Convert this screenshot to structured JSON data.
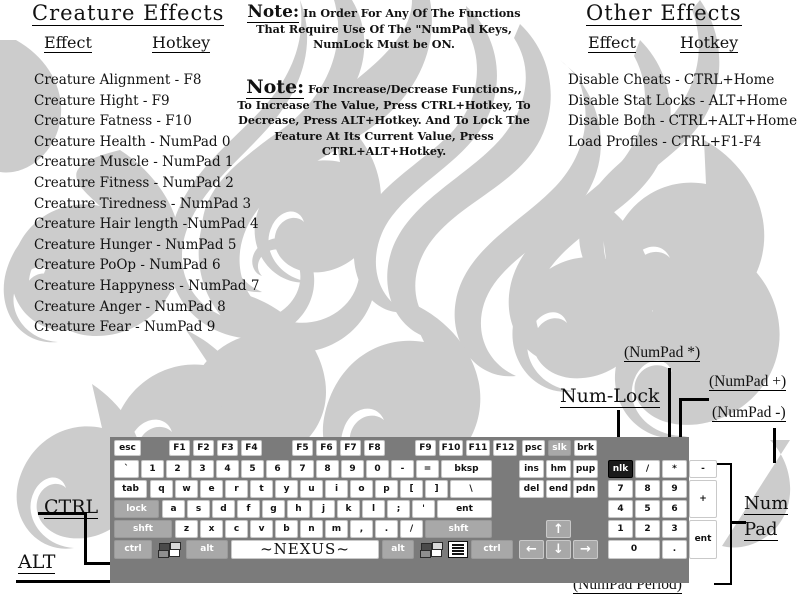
{
  "meta": {
    "accent_dark": "#1b1b1b",
    "key_face": "#ffffff",
    "key_grey": "#a8a8a8",
    "keyboard_body": "#7b7b7b",
    "watermark": "#cccccc"
  },
  "creature_effects": {
    "title": "Creature Effects",
    "col_effect": "Effect",
    "col_hotkey": "Hotkey",
    "rows": [
      "Creature Alignment - F8",
      "Creature Hight - F9",
      "Creature Fatness - F10",
      "Creature Health - NumPad 0",
      "Creature Muscle - NumPad 1",
      "Creature Fitness - NumPad 2",
      "Creature Tiredness - NumPad 3",
      "Creature Hair length -NumPad 4",
      "Creature Hunger - NumPad 5",
      "Creature PoOp - NumPad 6",
      "Creature Happyness - NumPad 7",
      "Creature Anger - NumPad 8",
      "Creature Fear - NumPad 9"
    ]
  },
  "note1": {
    "label": "Note:",
    "lines": [
      "In Order For Any Of The Functions",
      "That Require Use Of The \"NumPad Keys,",
      "NumLock Must be ON."
    ]
  },
  "note2": {
    "label": "Note:",
    "lines": [
      "For Increase/Decrease Functions,,",
      "To Increase The Value, Press CTRL+Hotkey, To",
      "Decrease, Press ALT+Hotkey. And To Lock The",
      "Feature At Its Current Value, Press CTRL+ALT+Hotkey."
    ]
  },
  "other_effects": {
    "title": "Other Effects",
    "col_effect": "Effect",
    "col_hotkey": "Hotkey",
    "rows": [
      "Disable Cheats - CTRL+Home",
      "Disable Stat Locks - ALT+Home",
      "Disable Both - CTRL+ALT+Home",
      "Load Profiles - CTRL+F1-F4"
    ]
  },
  "callouts": {
    "numpad_star": "(NumPad *)",
    "numpad_plus": "(NumPad +)",
    "numpad_minus": "(NumPad -)",
    "num_lock": "Num-Lock",
    "num_pad_line1": "Num",
    "num_pad_line2": "Pad",
    "ctrl": "CTRL",
    "alt": "ALT",
    "numpad_period": "(NumPad Period)"
  },
  "keyboard": {
    "rows": {
      "function_row": [
        {
          "label": "esc",
          "style": "white",
          "w": 26
        },
        {
          "label": "F1",
          "style": "white",
          "w": 22
        },
        {
          "label": "F2",
          "style": "white",
          "w": 22
        },
        {
          "label": "F3",
          "style": "white",
          "w": 22
        },
        {
          "label": "F4",
          "style": "white",
          "w": 22
        },
        {
          "label": "F5",
          "style": "white",
          "w": 22
        },
        {
          "label": "F6",
          "style": "white",
          "w": 22
        },
        {
          "label": "F7",
          "style": "white",
          "w": 22
        },
        {
          "label": "F8",
          "style": "white",
          "w": 22
        },
        {
          "label": "F9",
          "style": "white",
          "w": 22
        },
        {
          "label": "F10",
          "style": "white",
          "w": 22
        },
        {
          "label": "F11",
          "style": "white",
          "w": 22
        },
        {
          "label": "F12",
          "style": "white",
          "w": 22
        },
        {
          "label": "psc",
          "style": "white",
          "w": 22
        },
        {
          "label": "slk",
          "style": "grey",
          "w": 22
        },
        {
          "label": "brk",
          "style": "white",
          "w": 22
        }
      ],
      "number_row": [
        {
          "label": "`",
          "style": "white"
        },
        {
          "label": "1",
          "style": "white"
        },
        {
          "label": "2",
          "style": "white"
        },
        {
          "label": "3",
          "style": "white"
        },
        {
          "label": "4",
          "style": "white"
        },
        {
          "label": "5",
          "style": "white"
        },
        {
          "label": "6",
          "style": "white"
        },
        {
          "label": "7",
          "style": "white"
        },
        {
          "label": "8",
          "style": "white"
        },
        {
          "label": "9",
          "style": "white"
        },
        {
          "label": "0",
          "style": "white"
        },
        {
          "label": "-",
          "style": "white"
        },
        {
          "label": "=",
          "style": "white"
        },
        {
          "label": "bksp",
          "style": "white"
        },
        {
          "label": "ins",
          "style": "white"
        },
        {
          "label": "hm",
          "style": "white"
        },
        {
          "label": "pup",
          "style": "white"
        }
      ],
      "tab_row": [
        {
          "label": "tab",
          "style": "white"
        },
        {
          "label": "q",
          "style": "white"
        },
        {
          "label": "w",
          "style": "white"
        },
        {
          "label": "e",
          "style": "white"
        },
        {
          "label": "r",
          "style": "white"
        },
        {
          "label": "t",
          "style": "white"
        },
        {
          "label": "y",
          "style": "white"
        },
        {
          "label": "u",
          "style": "white"
        },
        {
          "label": "i",
          "style": "white"
        },
        {
          "label": "o",
          "style": "white"
        },
        {
          "label": "p",
          "style": "white"
        },
        {
          "label": "[",
          "style": "white"
        },
        {
          "label": "]",
          "style": "white"
        },
        {
          "label": "\\",
          "style": "white"
        },
        {
          "label": "del",
          "style": "white"
        },
        {
          "label": "end",
          "style": "white"
        },
        {
          "label": "pdn",
          "style": "white"
        }
      ],
      "home_row": [
        {
          "label": "lock",
          "style": "grey"
        },
        {
          "label": "a",
          "style": "white"
        },
        {
          "label": "s",
          "style": "white"
        },
        {
          "label": "d",
          "style": "white"
        },
        {
          "label": "f",
          "style": "white"
        },
        {
          "label": "g",
          "style": "white"
        },
        {
          "label": "h",
          "style": "white"
        },
        {
          "label": "j",
          "style": "white"
        },
        {
          "label": "k",
          "style": "white"
        },
        {
          "label": "l",
          "style": "white"
        },
        {
          "label": ";",
          "style": "white"
        },
        {
          "label": "'",
          "style": "white"
        },
        {
          "label": "ent",
          "style": "white"
        }
      ],
      "shift_row": [
        {
          "label": "shft",
          "style": "grey"
        },
        {
          "label": "z",
          "style": "white"
        },
        {
          "label": "x",
          "style": "white"
        },
        {
          "label": "c",
          "style": "white"
        },
        {
          "label": "v",
          "style": "white"
        },
        {
          "label": "b",
          "style": "white"
        },
        {
          "label": "n",
          "style": "white"
        },
        {
          "label": "m",
          "style": "white"
        },
        {
          "label": ",",
          "style": "white"
        },
        {
          "label": ".",
          "style": "white"
        },
        {
          "label": "/",
          "style": "white"
        },
        {
          "label": "shft",
          "style": "grey"
        }
      ],
      "bottom_row": [
        {
          "label": "ctrl",
          "style": "grey"
        },
        {
          "label": "win-key",
          "style": "icon"
        },
        {
          "label": "alt",
          "style": "grey"
        },
        {
          "label": "~NEXUS~",
          "style": "space"
        },
        {
          "label": "alt",
          "style": "grey"
        },
        {
          "label": "win-key",
          "style": "icon"
        },
        {
          "label": "menu-key",
          "style": "icon"
        },
        {
          "label": "ctrl",
          "style": "grey"
        }
      ],
      "arrows": [
        {
          "label": "↑",
          "style": "arrow"
        },
        {
          "label": "←",
          "style": "arrow"
        },
        {
          "label": "↓",
          "style": "arrow"
        },
        {
          "label": "→",
          "style": "arrow"
        }
      ]
    },
    "numpad": [
      {
        "label": "nlk",
        "style": "dark"
      },
      {
        "label": "/",
        "style": "white"
      },
      {
        "label": "*",
        "style": "white"
      },
      {
        "label": "-",
        "style": "white"
      },
      {
        "label": "7",
        "style": "white"
      },
      {
        "label": "8",
        "style": "white"
      },
      {
        "label": "9",
        "style": "white"
      },
      {
        "label": "+",
        "style": "white"
      },
      {
        "label": "4",
        "style": "white"
      },
      {
        "label": "5",
        "style": "white"
      },
      {
        "label": "6",
        "style": "white"
      },
      {
        "label": "1",
        "style": "white"
      },
      {
        "label": "2",
        "style": "white"
      },
      {
        "label": "3",
        "style": "white"
      },
      {
        "label": "ent",
        "style": "white"
      },
      {
        "label": "0",
        "style": "white"
      },
      {
        "label": ".",
        "style": "white"
      }
    ]
  }
}
